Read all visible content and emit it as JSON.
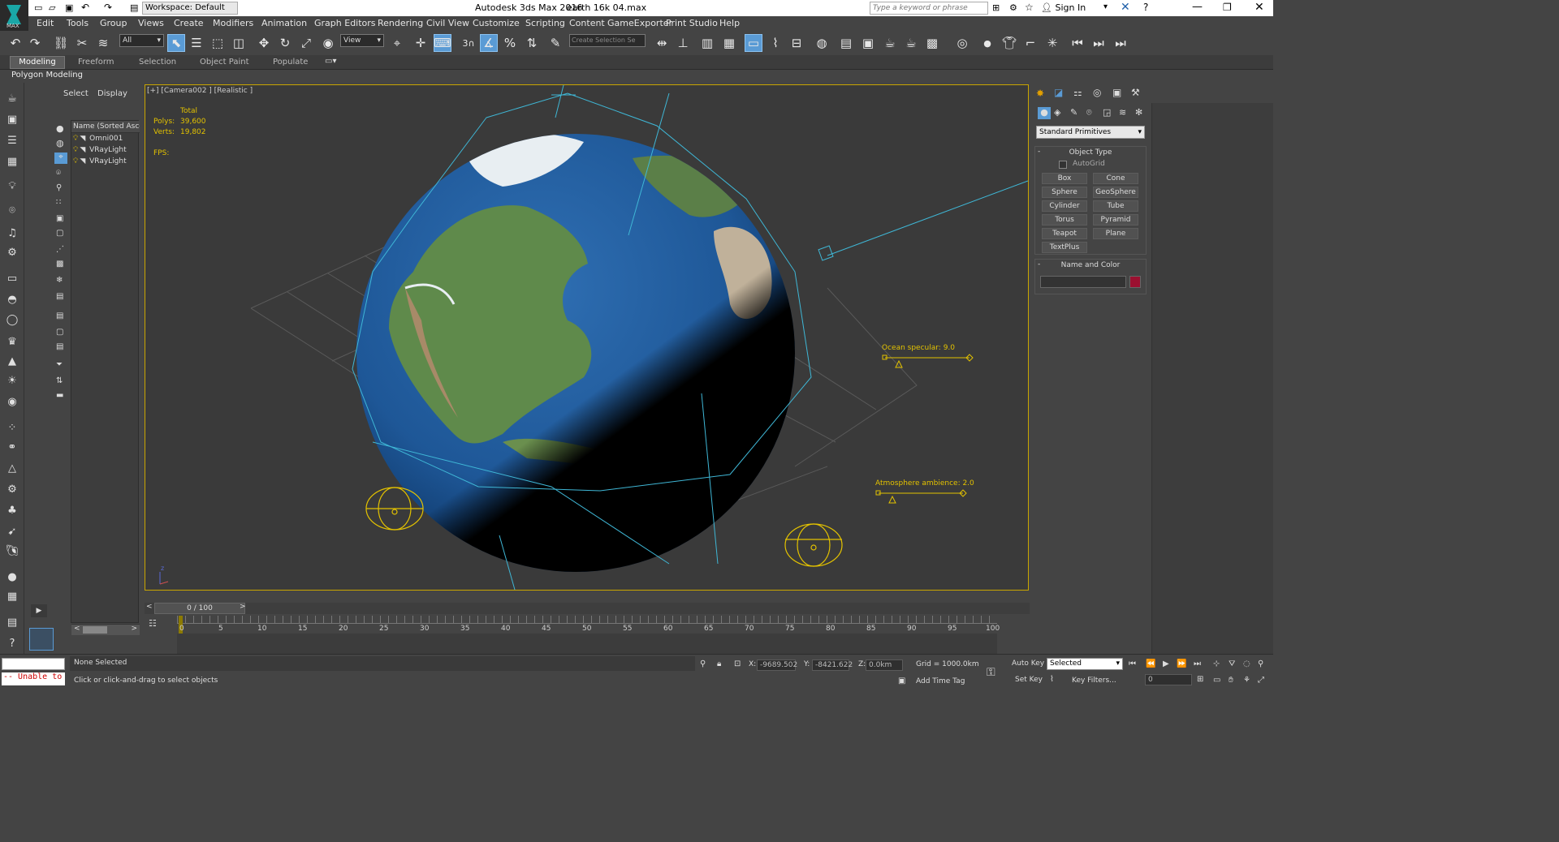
{
  "titlebar": {
    "workspace_label": "Workspace: Default",
    "app_title": "Autodesk 3ds Max 2016",
    "file_name": "earth 16k 04.max",
    "search_placeholder": "Type a keyword or phrase",
    "signin_label": "Sign In"
  },
  "app_menu_label": "MAX",
  "menu": [
    "Edit",
    "Tools",
    "Group",
    "Views",
    "Create",
    "Modifiers",
    "Animation",
    "Graph Editors",
    "Rendering",
    "Civil View",
    "Customize",
    "Scripting",
    "Content",
    "GameExporter",
    "Print Studio",
    "Help"
  ],
  "toolbar": {
    "selection_filter": "All",
    "reference_coord": "View",
    "snap_label": "3",
    "named_selection_placeholder": "Create Selection Se"
  },
  "ribbon": {
    "tabs": [
      "Modeling",
      "Freeform",
      "Selection",
      "Object Paint",
      "Populate"
    ],
    "active_tab": "Modeling",
    "subtitle": "Polygon Modeling"
  },
  "scene_explorer": {
    "tabs": [
      "Select",
      "Display"
    ],
    "column_header": "Name (Sorted Ascen",
    "items": [
      "Omni001",
      "VRayLight",
      "VRayLight"
    ]
  },
  "viewport": {
    "label": "[+] [Camera002 ] [Realistic ]",
    "stats_header": "Total",
    "polys_label": "Polys:",
    "polys_value": "39,600",
    "verts_label": "Verts:",
    "verts_value": "19,802",
    "fps_label": "FPS:",
    "ocean_label": "Ocean specular: 9.0",
    "atmosphere_label": "Atmosphere ambience: 2.0"
  },
  "command_panel": {
    "category": "Standard Primitives",
    "object_type_header": "Object Type",
    "autogrid_label": "AutoGrid",
    "buttons": [
      "Box",
      "Cone",
      "Sphere",
      "GeoSphere",
      "Cylinder",
      "Tube",
      "Torus",
      "Pyramid",
      "Teapot",
      "Plane",
      "TextPlus"
    ],
    "name_color_header": "Name and Color",
    "object_color": "#9b1030"
  },
  "timeline": {
    "frame_counter": "0 / 100",
    "ticks": [
      "0",
      "5",
      "10",
      "15",
      "20",
      "25",
      "30",
      "35",
      "40",
      "45",
      "50",
      "55",
      "60",
      "65",
      "70",
      "75",
      "80",
      "85",
      "90",
      "95",
      "100"
    ]
  },
  "statusbar": {
    "maxscript_text": "-- Unable to",
    "selection_status": "None Selected",
    "prompt": "Click or click-and-drag to select objects",
    "x_label": "X:",
    "x_value": "-9689.502",
    "y_label": "Y:",
    "y_value": "-8421.622",
    "z_label": "Z:",
    "z_value": "0.0km",
    "grid_label": "Grid = 1000.0km",
    "add_time_tag": "Add Time Tag",
    "auto_key": "Auto Key",
    "set_key": "Set Key",
    "selected_dropdown": "Selected",
    "key_filters": "Key Filters...",
    "frame_field": "0"
  },
  "colors": {
    "viewport_border": "#c9a600",
    "active_blue": "#5a9bd5",
    "helper_cyan": "#3fb7d6",
    "light_yellow": "#e3c200"
  }
}
